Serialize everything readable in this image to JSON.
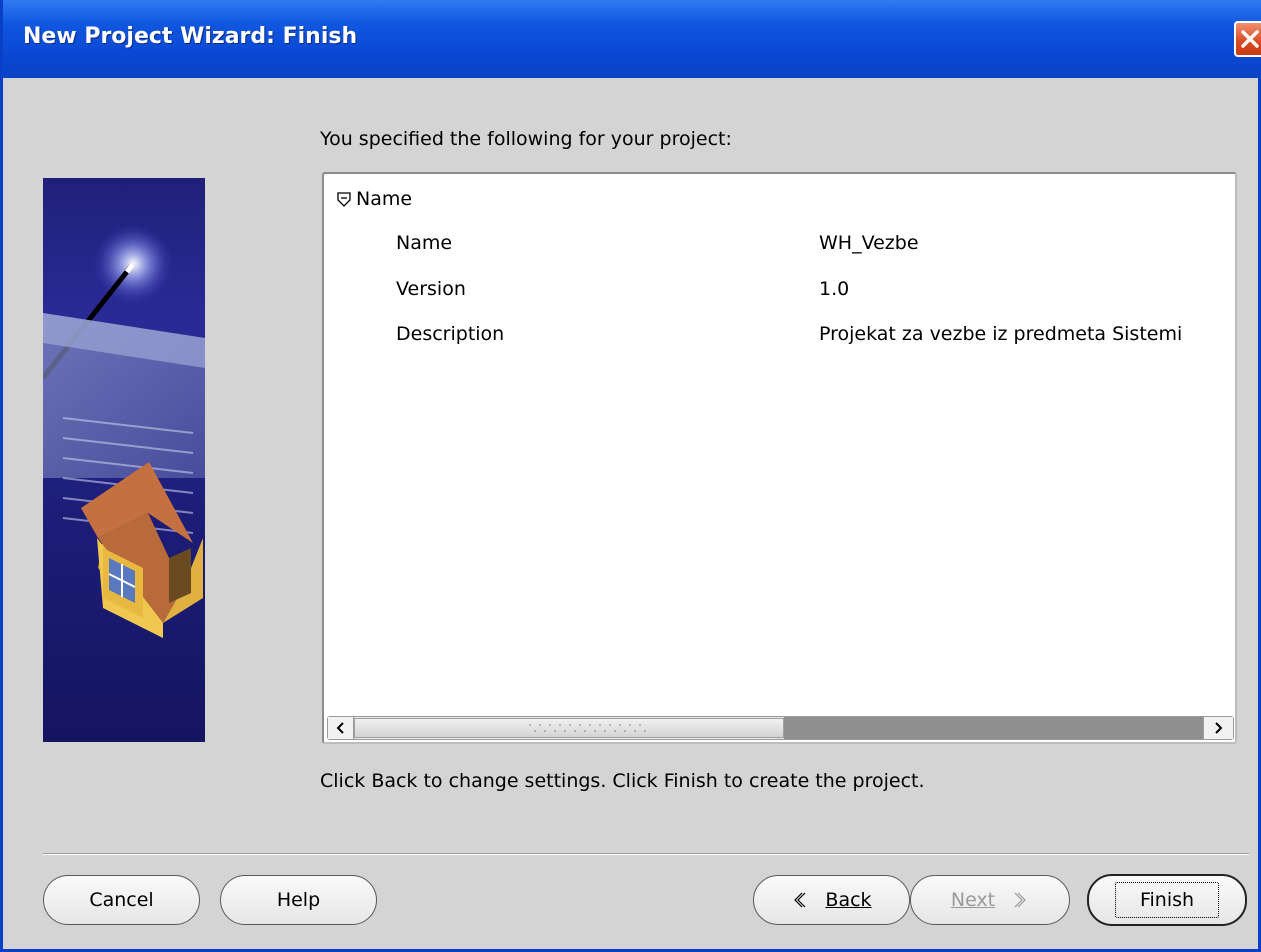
{
  "window": {
    "title": "New Project Wizard: Finish",
    "close_icon": "close-icon"
  },
  "content": {
    "intro": "You specified the following for your project:",
    "tree": {
      "group_label": "Name",
      "group_icon": "collapse-icon",
      "rows": [
        {
          "label": "Name",
          "value": "WH_Vezbe"
        },
        {
          "label": "Version",
          "value": "1.0"
        },
        {
          "label": "Description",
          "value": "Projekat za vezbe iz predmeta Sistemi"
        }
      ]
    },
    "footer_message": "Click Back to change settings. Click Finish to create the project."
  },
  "buttons": {
    "cancel": "Cancel",
    "help": "Help",
    "back": "Back",
    "next": "Next",
    "finish": "Finish"
  },
  "colors": {
    "title_bar": "#0a48d4",
    "close_button": "#d84a23",
    "dialog_bg": "#d4d4d4",
    "banner_bg": "#1d1d78"
  }
}
